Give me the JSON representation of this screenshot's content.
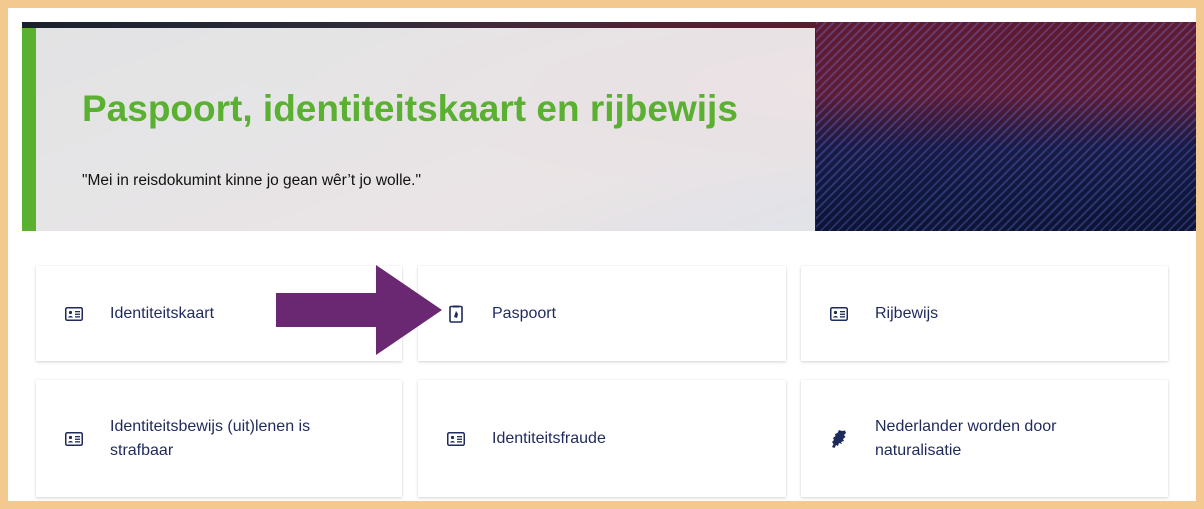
{
  "hero": {
    "title": "Paspoort, identiteitskaart en rijbewijs",
    "subtitle": "\"Mei in reisdokumint kinne jo gean wêr’t jo wolle.\""
  },
  "cards": [
    {
      "label": "Identiteitskaart",
      "icon": "id-card-icon"
    },
    {
      "label": "Paspoort",
      "icon": "passport-icon"
    },
    {
      "label": "Rijbewijs",
      "icon": "id-card-icon"
    },
    {
      "label": "Identiteitsbewijs (uit)lenen is strafbaar",
      "icon": "id-card-icon"
    },
    {
      "label": "Identiteitsfraude",
      "icon": "id-card-icon"
    },
    {
      "label": "Nederlander worden door naturalisatie",
      "icon": "netherlands-map-icon"
    }
  ],
  "colors": {
    "accent_green": "#5ab031",
    "link_text": "#1f2a5c",
    "arrow": "#6a2873",
    "frame": "#f4c98f"
  }
}
